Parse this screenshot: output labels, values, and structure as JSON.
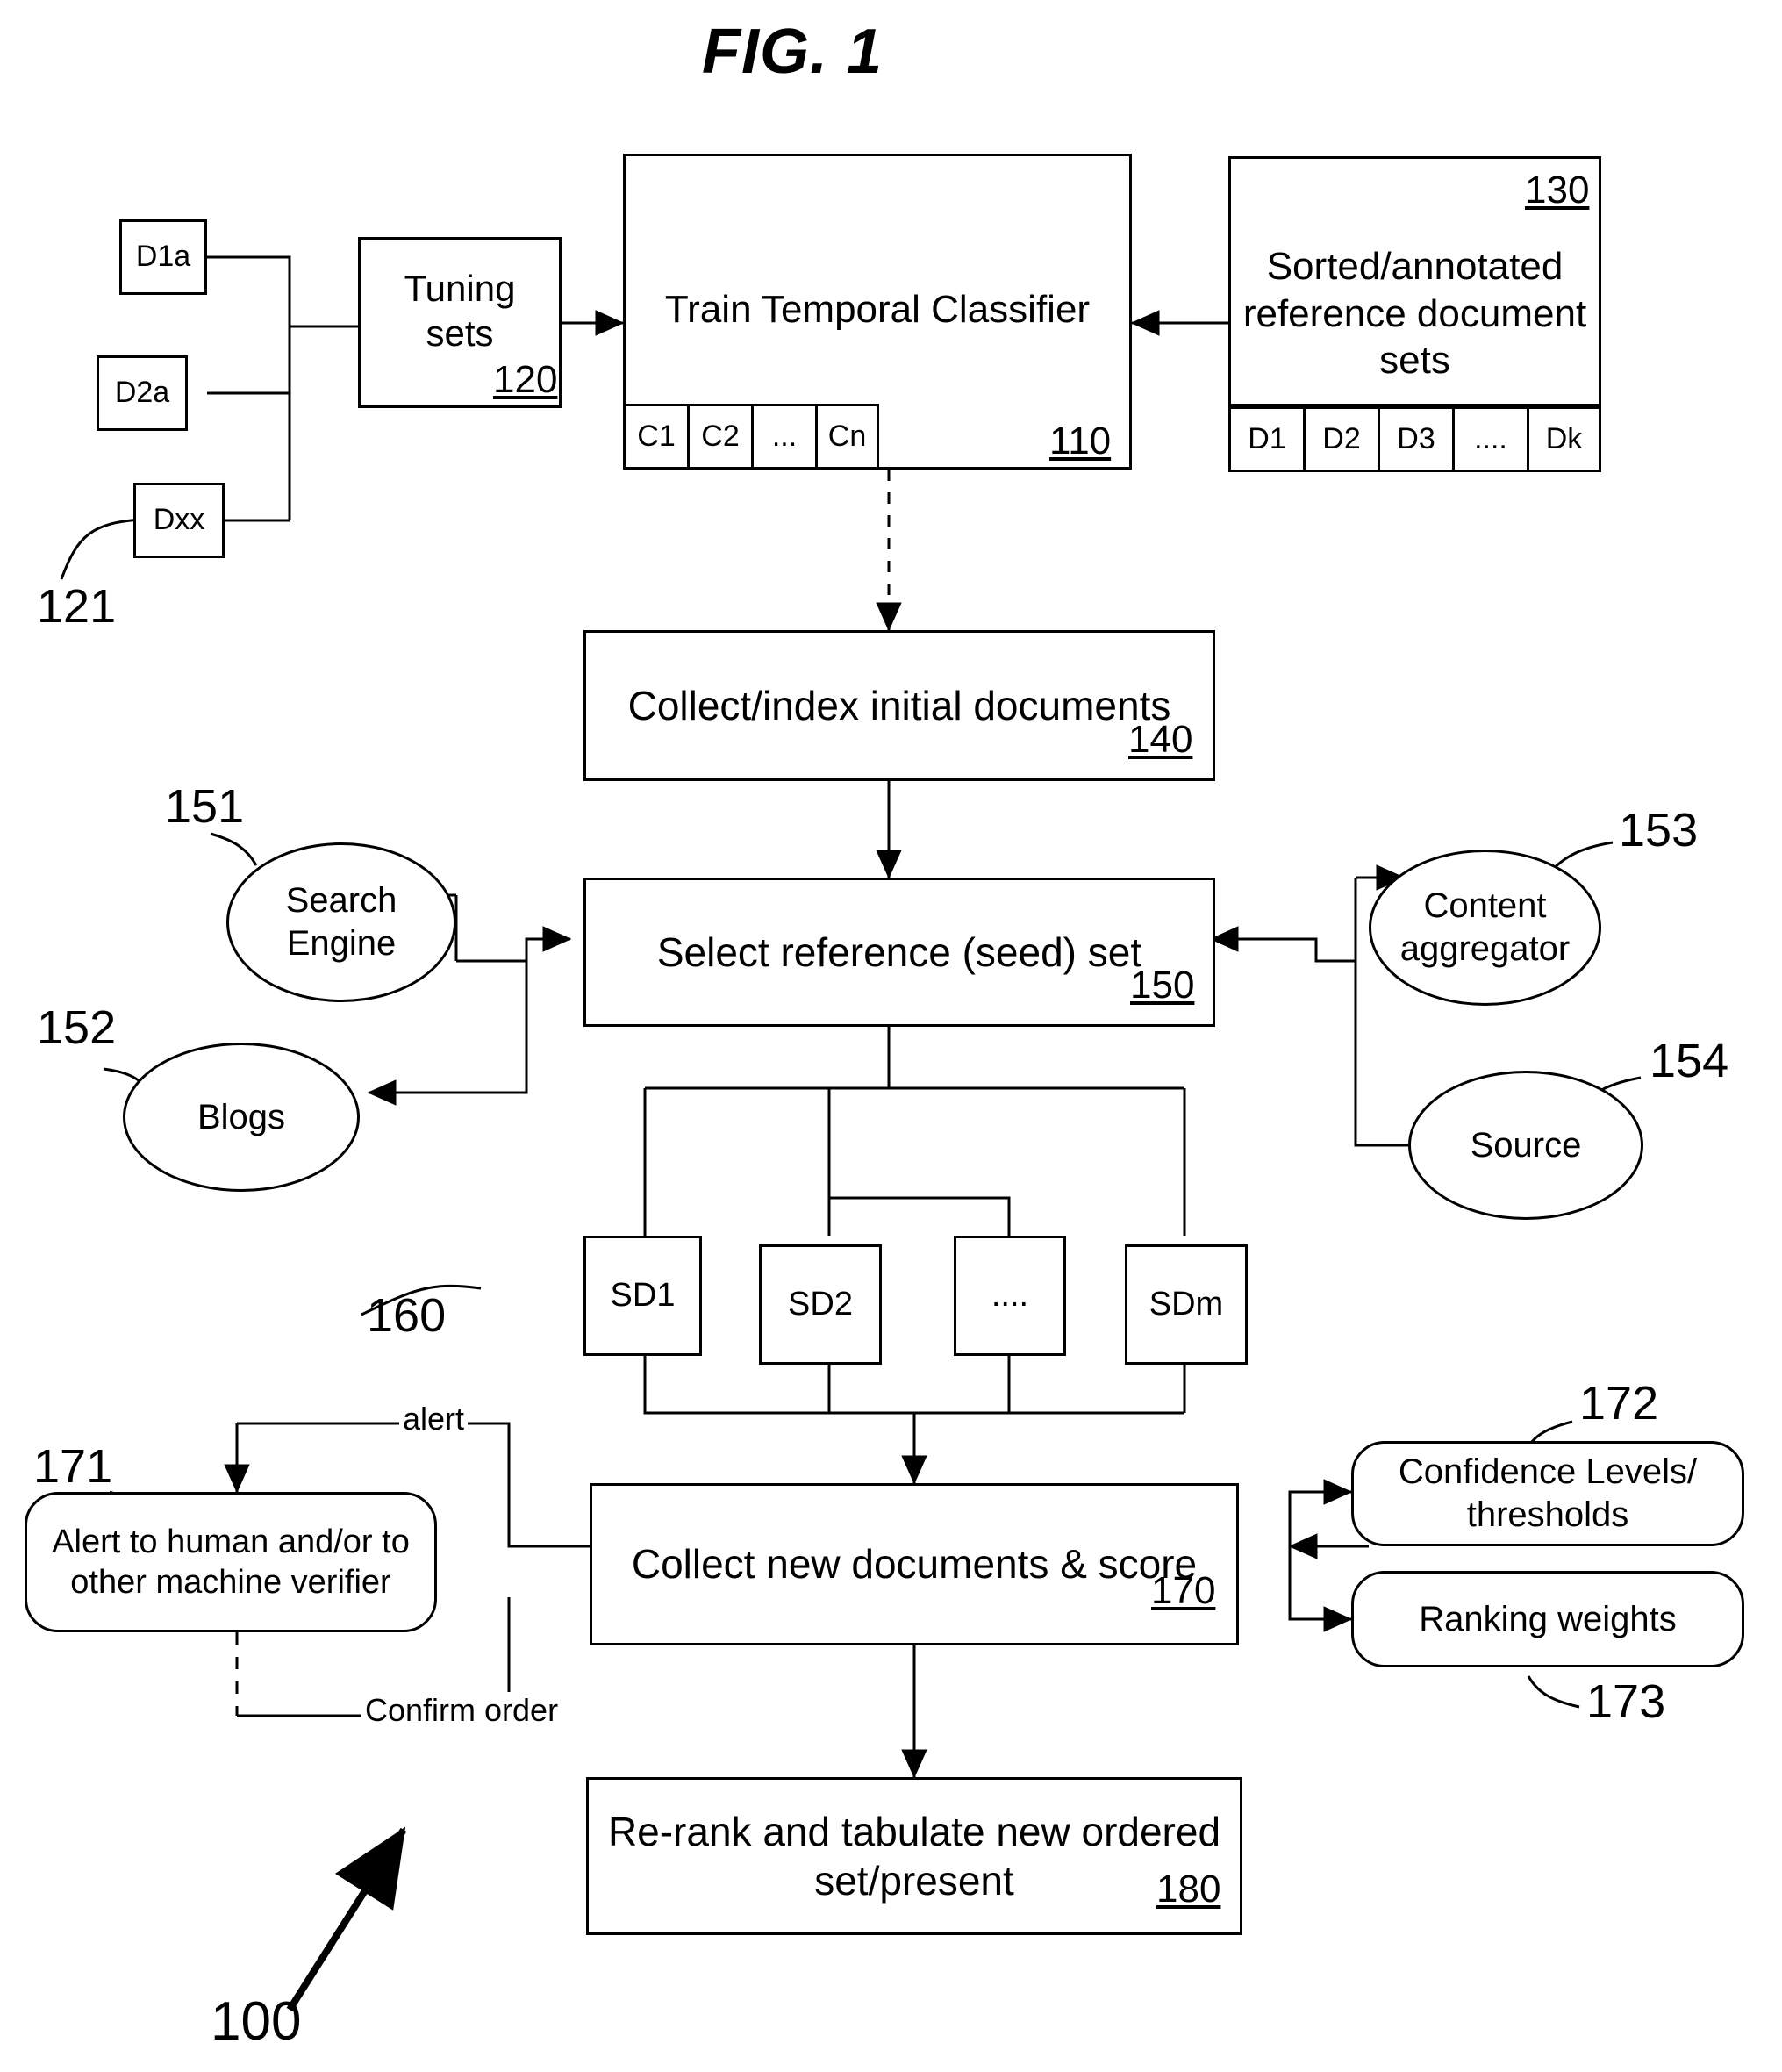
{
  "figure": {
    "title": "FIG. 1",
    "system_ref": "100"
  },
  "tuning_inputs": {
    "group_ref": "121",
    "items": [
      {
        "label": "D1a"
      },
      {
        "label": "D2a"
      },
      {
        "label": "Dxx"
      }
    ]
  },
  "nodes": {
    "tuning_sets": {
      "label": "Tuning sets",
      "ref": "120"
    },
    "train_classifier": {
      "label": "Train Temporal Classifier",
      "ref": "110"
    },
    "reference_sets": {
      "label": "Sorted/annotated reference document sets",
      "ref": "130"
    },
    "collect_index": {
      "label": "Collect/index initial documents",
      "ref": "140"
    },
    "select_seed": {
      "label": "Select reference (seed) set",
      "ref": "150"
    },
    "collect_score": {
      "label": "Collect new documents & score",
      "ref": "170"
    },
    "rerank": {
      "label": "Re-rank and tabulate new ordered set/present",
      "ref": "180"
    },
    "alert": {
      "label": "Alert to human and/or to other machine verifier",
      "ref": "171"
    },
    "confidence": {
      "label": "Confidence Levels/ thresholds",
      "ref": "172"
    },
    "ranking": {
      "label": "Ranking weights",
      "ref": "173"
    }
  },
  "classifier_cells": [
    {
      "label": "C1"
    },
    {
      "label": "C2"
    },
    {
      "label": "..."
    },
    {
      "label": "Cn"
    }
  ],
  "reference_cells": [
    {
      "label": "D1"
    },
    {
      "label": "D2"
    },
    {
      "label": "D3"
    },
    {
      "label": "...."
    },
    {
      "label": "Dk"
    }
  ],
  "sources": [
    {
      "label": "Search Engine",
      "ref": "151"
    },
    {
      "label": "Blogs",
      "ref": "152"
    },
    {
      "label": "Content aggregator",
      "ref": "153"
    },
    {
      "label": "Source",
      "ref": "154"
    }
  ],
  "seed_documents": {
    "group_ref": "160",
    "items": [
      {
        "label": "SD1"
      },
      {
        "label": "SD2"
      },
      {
        "label": "...."
      },
      {
        "label": "SDm"
      }
    ]
  },
  "edge_labels": {
    "alert": "alert",
    "confirm_order": "Confirm order"
  },
  "colors": {
    "ink": "#000000",
    "paper": "#ffffff"
  }
}
